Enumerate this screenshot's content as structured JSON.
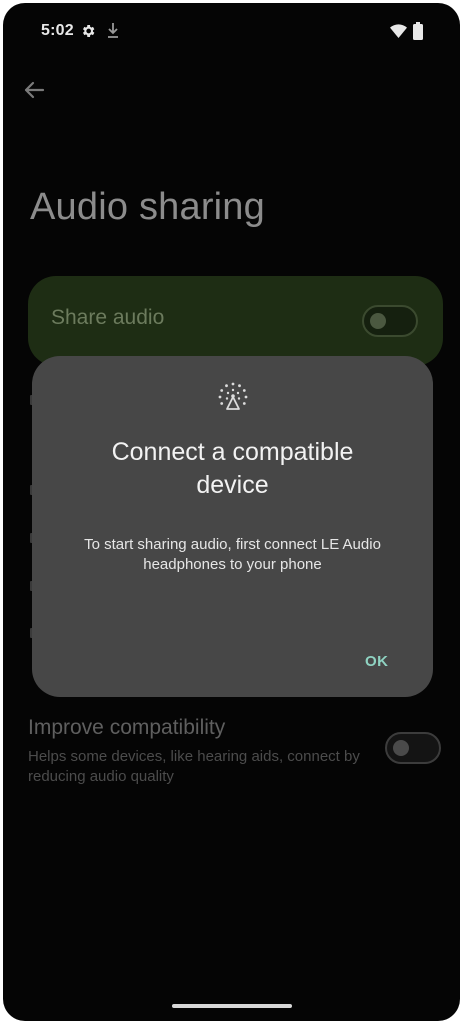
{
  "status_bar": {
    "time": "5:02",
    "icons": [
      "settings-icon",
      "download-icon",
      "wifi-icon",
      "battery-icon"
    ]
  },
  "navigation": {
    "back_icon": "arrow-left-icon"
  },
  "page": {
    "title": "Audio sharing"
  },
  "share_audio": {
    "label": "Share audio",
    "toggle_on": false
  },
  "improve_compatibility": {
    "title": "Improve compatibility",
    "description": "Helps some devices, like hearing aids, connect by reducing audio quality",
    "toggle_on": false
  },
  "dialog": {
    "icon": "broadcast-icon",
    "title": "Connect a compatible device",
    "body": "To start sharing audio, first connect LE Audio headphones to your phone",
    "ok_label": "OK"
  },
  "colors": {
    "background": "#050505",
    "dialog_surface": "#474747",
    "share_card": "#1e2d14",
    "accent_ok": "#8fd3c2"
  }
}
